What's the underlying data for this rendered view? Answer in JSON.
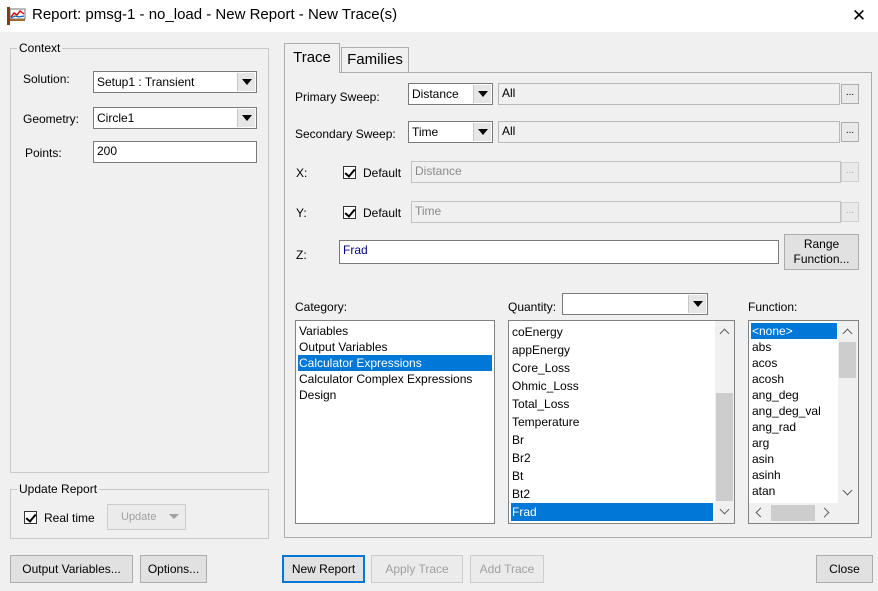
{
  "window": {
    "title": "Report: pmsg-1 - no_load - New Report - New Trace(s)"
  },
  "context": {
    "legend": "Context",
    "solution_label": "Solution:",
    "solution_value": "Setup1 : Transient",
    "geometry_label": "Geometry:",
    "geometry_value": "Circle1",
    "points_label": "Points:",
    "points_value": "200"
  },
  "update_report": {
    "legend": "Update Report",
    "realtime_label": "Real time",
    "realtime_checked": true,
    "update_button": "Update"
  },
  "tabs": [
    {
      "label": "Trace",
      "active": true
    },
    {
      "label": "Families",
      "active": false
    }
  ],
  "trace": {
    "primary_sweep_label": "Primary Sweep:",
    "primary_sweep_value": "Distance",
    "primary_sweep_range": "All",
    "secondary_sweep_label": "Secondary Sweep:",
    "secondary_sweep_value": "Time",
    "secondary_sweep_range": "All",
    "x_label": "X:",
    "x_default_label": "Default",
    "x_value": "Distance",
    "y_label": "Y:",
    "y_default_label": "Default",
    "y_value": "Time",
    "z_label": "Z:",
    "z_value": "Frad",
    "range_function_line1": "Range",
    "range_function_line2": "Function...",
    "dots": "..."
  },
  "category": {
    "label": "Category:",
    "items": [
      "Variables",
      "Output Variables",
      "Calculator Expressions",
      "Calculator Complex Expressions",
      "Design"
    ],
    "selected": "Calculator Expressions"
  },
  "quantity": {
    "label": "Quantity:",
    "filter_value": "",
    "items": [
      "coEnergy",
      "appEnergy",
      "Core_Loss",
      "Ohmic_Loss",
      "Total_Loss",
      "Temperature",
      "Br",
      "Br2",
      "Bt",
      "Bt2",
      "Frad"
    ],
    "selected": "Frad"
  },
  "function": {
    "label": "Function:",
    "items": [
      "<none>",
      "abs",
      "acos",
      "acosh",
      "ang_deg",
      "ang_deg_val",
      "ang_rad",
      "arg",
      "asin",
      "asinh",
      "atan"
    ],
    "selected": "<none>"
  },
  "buttons": {
    "output_variables": "Output Variables...",
    "options": "Options...",
    "new_report": "New Report",
    "apply_trace": "Apply Trace",
    "add_trace": "Add Trace",
    "close": "Close"
  },
  "colors": {
    "selection": "#0078d7",
    "z_text": "#00008b"
  }
}
